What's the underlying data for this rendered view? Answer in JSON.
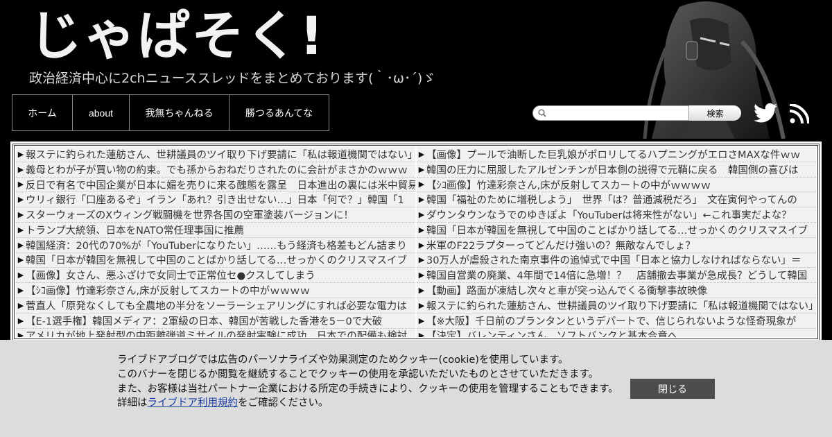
{
  "site": {
    "logo_text": "じゃぱそく!",
    "tagline": "政治経済中心に2chニューススレッドをまとめております(｀･ω･´)ゞ"
  },
  "nav": {
    "items": [
      {
        "label": "ホーム"
      },
      {
        "label": "about"
      },
      {
        "label": "我無ちゃんねる"
      },
      {
        "label": "勝つるあんてな"
      }
    ]
  },
  "search": {
    "placeholder": "",
    "value": "",
    "button_label": "検索"
  },
  "icons": {
    "twitter": "twitter-icon",
    "rss": "rss-icon",
    "search": "search-icon",
    "arrow": "triangle-right-icon"
  },
  "colors": {
    "background": "#000000",
    "list_background": "#f1f1f1",
    "cookie_background": "#dcdcdc",
    "close_button": "#4d4d4d",
    "link": "#1a3ea0"
  },
  "articles": {
    "left": [
      "報ステに釣られた蓮舫さん、世耕議員のツイ取り下げ要請に「私は報道機関ではない」",
      "義母とわが子が買い物の約束。でも孫からおねだりされたのに会計がまさかのｗｗｗ",
      "反日で有名で中国企業が日本に媚を売りに来る醜態を露呈　日本進出の裏には米中貿易",
      "ウリィ銀行「口座あるぞ」イラン「あれ？引き出せない…」日本「何で？」韓国「1",
      "スターウォーズのXウィング戦闘機を世界各国の空軍塗装バージョンに！",
      "トランプ大統領、日本をNATO常任理事国に推薦",
      "韓国経済：20代の70%が「YouTuberになりたい」……もう経済も格差もどん詰まり",
      "韓国「日本が韓国を無視して中国のことばかり話してる…せっかくのクリスマスイブ",
      "【画像】女さん、悪ふざけで女同士で正常位セ●クスしてしまう",
      "【ｼｺ画像】竹達彩奈さん,床が反射してスカートの中がｗｗｗｗ",
      "菅直人「原発なくしても全農地の半分をソーラーシェアリングにすれば必要な電力は",
      "【E-1選手権】韓国メディア：2軍級の日本、韓国が苦戦した香港を5－0で大破",
      "アメリカが地上発射型の中距離弾道ミサイルの発射実験に成功…日本での配備も検討"
    ],
    "right": [
      "【画像】プールで油断した巨乳娘がポロリしてるハプニングがエロさMAXな件ｗｗ",
      "韓国の圧力に屈服したアルゼンチンが日本側の説得で元鞘に戻る　韓国側の喜びは",
      "【ｼｺ画像】竹達彩奈さん,床が反射してスカートの中がｗｗｗｗ",
      "韓国「福祉のために増税しよう」　世界「は？普通減税だろ」　文在寅何やってんの",
      "ダウンタウンなうでのゆきぽよ「YouTuberは将来性がない」←これ事実だよな？",
      "韓国「日本が韓国を無視して中国のことばかり話してる…せっかくのクリスマスイブ",
      "米軍のF22ラプターってどんだけ強いの？無敵なんでしょ？",
      "30万人が虐殺された南京事件の追悼式で中国「日本と協力しなければならない」＝",
      "韓国自営業の廃業、4年間で14倍に急増！？　店舗撤去事業が急成長？どうして韓国",
      "【動画】路面が凍結し次々と車が突っ込んでくる衝撃事故映像",
      "報ステに釣られた蓮舫さん、世耕議員のツイ取り下げ要請に「私は報道機関ではない」",
      "【※大阪】千日前のプランタンというデパートで、信じられないような怪奇現象が",
      "【決定】バレンティンさん、ソフトバンクと基本合意へ"
    ]
  },
  "cookie": {
    "line1": "ライブドアブログでは広告のパーソナライズや効果測定のためクッキー(cookie)を使用しています。",
    "line2": "このバナーを閉じるか閲覧を継続することでクッキーの使用を承認いただいたものとさせていただきます。",
    "line3": "また、お客様は当社パートナー企業における所定の手続きにより、クッキーの使用を管理することもできます。",
    "line4_prefix": "詳細は",
    "line4_link": "ライブドア利用規約",
    "line4_suffix": "をご確認ください。",
    "close_label": "閉じる"
  }
}
